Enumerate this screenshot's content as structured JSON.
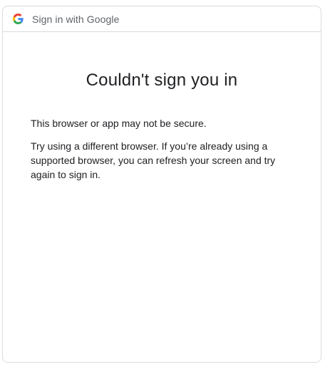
{
  "header": {
    "logo_icon": "google-g-icon",
    "title": "Sign in with Google"
  },
  "main": {
    "heading": "Couldn't sign you in",
    "paragraphs": [
      "This browser or app may not be secure.",
      "Try using a different browser. If you’re already using a supported browser, you can refresh your screen and try again to sign in."
    ]
  },
  "colors": {
    "border": "#dadce0",
    "text_primary": "#202124",
    "text_secondary": "#5f6368",
    "google_blue": "#4285F4",
    "google_red": "#EA4335",
    "google_yellow": "#FBBC05",
    "google_green": "#34A853"
  }
}
